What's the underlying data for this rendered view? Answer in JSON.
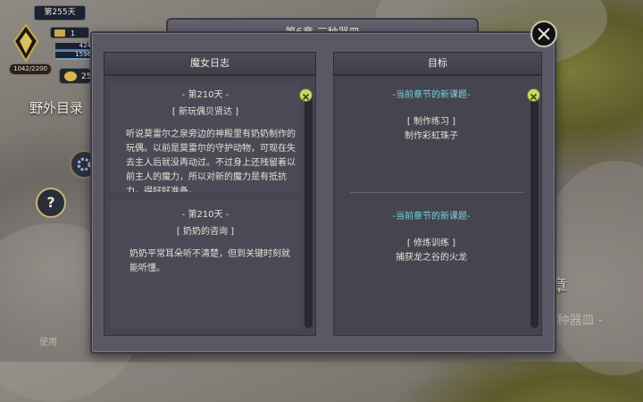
{
  "hud": {
    "day": "第255天",
    "hp": "1042/2200",
    "resource_count": "1",
    "bar_values": [
      "424",
      "1596"
    ],
    "coins": "25",
    "map_button": "野外目录",
    "help_label": "?",
    "use_label": "使用"
  },
  "background": {
    "chapter_fragment": "章",
    "subtitle_fragment": "- 三种器皿 -"
  },
  "modal": {
    "title": "第6章  三种器皿",
    "diary": {
      "header": "魔女日志",
      "entries": [
        {
          "day": "- 第210天 -",
          "title": "[ 新玩偶贝贤达 ]",
          "body": "听说莫雷尔之泉旁边的神殿里有奶奶制作的玩偶。以前是莫雷尔的守护动物，可现在失去主人后就没再动过。不过身上还残留着以前主人的魔力，所以对新的魔力是有抵抗力。得好好准备。"
        },
        {
          "day": "- 第210天 -",
          "title": "[ 奶奶的咨询 ]",
          "body": "奶奶平常耳朵听不清楚，但到关键时刻就能听懂。"
        }
      ]
    },
    "goals": {
      "header": "目标",
      "quests": [
        {
          "header": "-当前章节的新课题-",
          "label": "[ 制作练习 ]",
          "name": "制作彩虹珠子"
        },
        {
          "header": "-当前章节的新课题-",
          "label": "[ 修炼训练 ]",
          "name": "捕获龙之谷的火龙"
        }
      ]
    }
  },
  "colors": {
    "accent_cyan": "#73d6e0",
    "scroll_close": "#c8d86a",
    "panel_bg": "#46444f"
  }
}
